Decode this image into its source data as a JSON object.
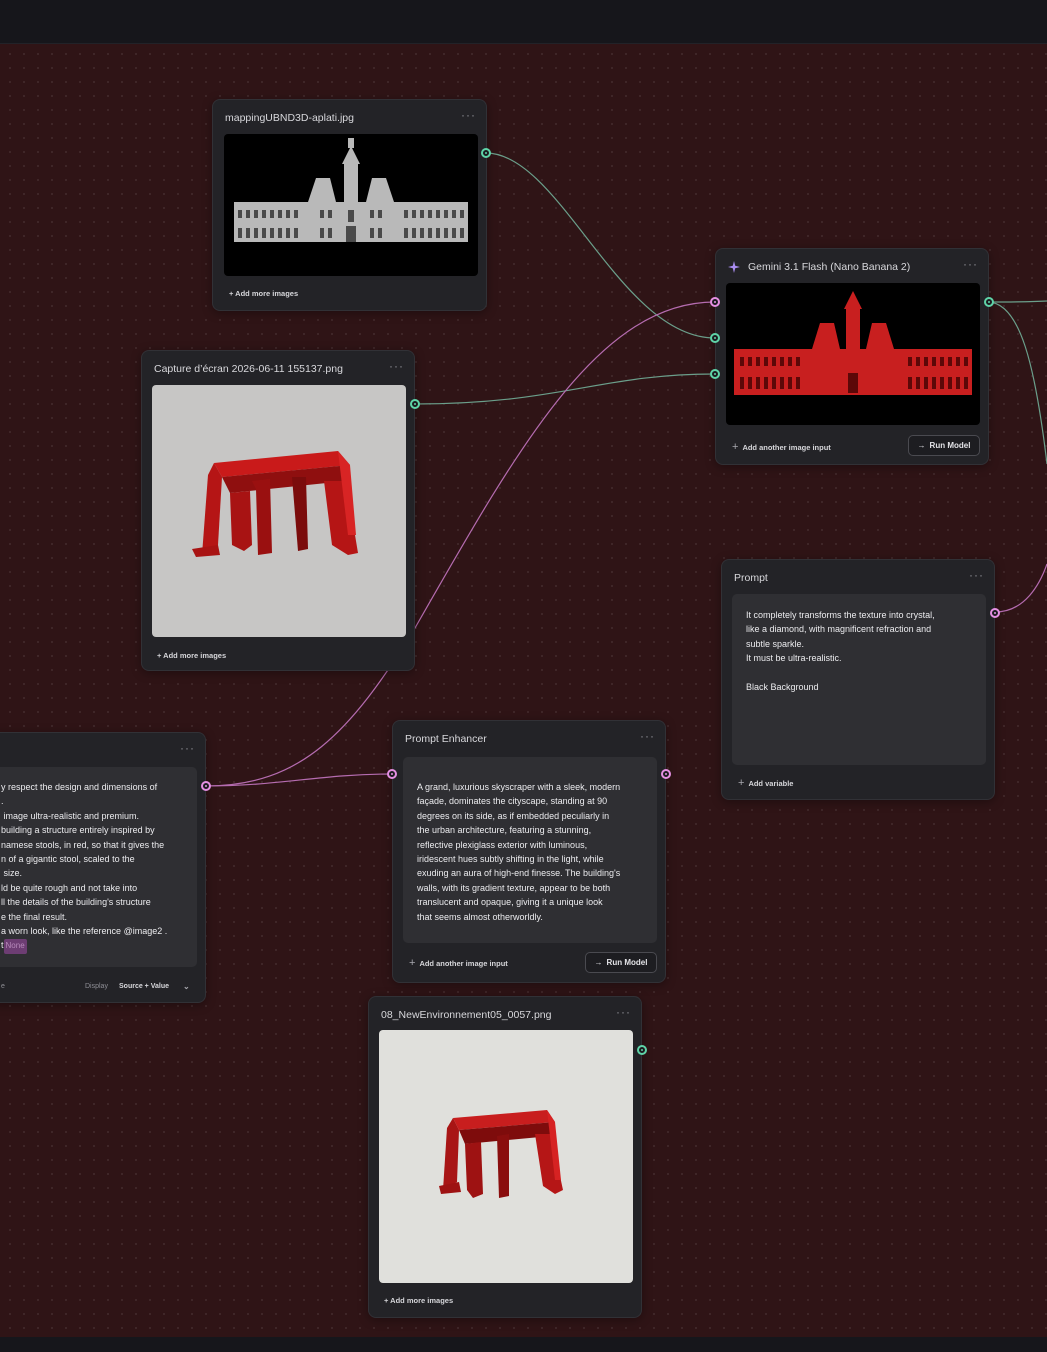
{
  "colors": {
    "canvas": "#2f1416",
    "node": "#232327",
    "image_port": "#5fd4a8",
    "text_port": "#e590e3",
    "gemini_star": "#a98cf0"
  },
  "node_image_1": {
    "title": "mappingUBND3D-aplati.jpg",
    "menu": "···",
    "add_label": "+ Add more images"
  },
  "node_image_2": {
    "title": "Capture d’écran 2026-06-11 155137.png",
    "menu": "···",
    "add_label": "+ Add more images"
  },
  "node_image_3": {
    "title": "08_NewEnvironnement05_0057.png",
    "menu": "···",
    "add_label": "+ Add more images"
  },
  "node_gemini": {
    "icon": "sparkle-icon",
    "title": "Gemini 3.1 Flash (Nano Banana 2)",
    "menu": "···",
    "add_label": "Add another image input",
    "run_label": "Run Model"
  },
  "node_prompt": {
    "title": "Prompt",
    "menu": "···",
    "lines": [
      "It completely transforms the texture into crystal,",
      "like a diamond, with magnificent refraction and",
      "subtle sparkle.",
      "It must be ultra-realistic.",
      "",
      "Black Background"
    ],
    "add_label": "Add variable"
  },
  "node_enhancer": {
    "title": "Prompt Enhancer",
    "menu": "···",
    "lines": [
      "A grand, luxurious skyscraper with a sleek, modern",
      "façade, dominates the cityscape, standing at 90",
      "degrees on its side, as if embedded peculiarly in",
      "the urban architecture, featuring a stunning,",
      "reflective plexiglass exterior with luminous,",
      "iridescent hues subtly shifting in the light, while",
      "exuding an aura of high-end finesse. The building's",
      "walls, with its gradient texture, appear to be both",
      "translucent and opaque, giving it a unique look",
      "that seems almost otherworldly."
    ],
    "add_label": "Add another image input",
    "run_label": "Run Model"
  },
  "node_partial": {
    "menu": "···",
    "lines": [
      "y respect the design and dimensions of",
      ".",
      " image ultra-realistic and premium.",
      "building a structure entirely inspired by",
      "namese stools, in red, so that it gives the",
      "n of a gigantic stool, scaled to the",
      " size.",
      "ld be quite rough and not take into",
      "ll the details of the building's structure",
      "e the final result.",
      "a worn look, like the reference @image2 ."
    ],
    "tag_prefix": "t",
    "tag_label": "None",
    "display_label": "Display",
    "display_value": "Source + Value",
    "left_glyph": "e"
  }
}
